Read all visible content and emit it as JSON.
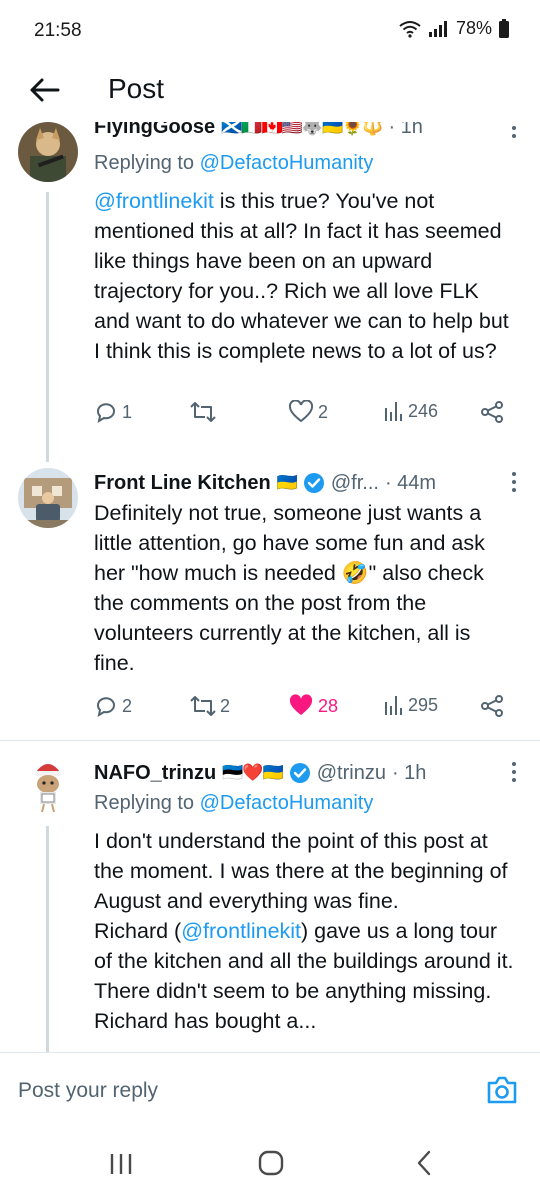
{
  "status_bar": {
    "time": "21:58",
    "battery": "78%"
  },
  "header": {
    "title": "Post"
  },
  "posts": [
    {
      "name": "FlyingGoose",
      "flags": "🏴󠁧󠁢󠁳󠁣󠁴󠁿🇮🇹🇨🇦🇺🇸🐺🇺🇦🌻🔱",
      "time": "· 1h",
      "replying_label": "Replying to",
      "replying_handle": "@DefactoHumanity",
      "text_link": "@frontlinekit",
      "text_rest": " is this true? You've not mentioned this at all? In fact it has seemed like things have been on an upward trajectory for you..? Rich we all love FLK and want to do whatever we can to help but I think this is complete news to a lot of us?",
      "replies": "1",
      "reposts": "",
      "likes": "2",
      "views": "246"
    },
    {
      "name": "Front Line Kitchen",
      "flags": "🇺🇦",
      "handle": "@fr...",
      "time": "· 44m",
      "text": "Definitely not true, someone just wants a little attention, go have some fun and ask her \"how much is needed 🤣\" also check the comments on the post from the volunteers currently at the kitchen, all is fine.",
      "replies": "2",
      "reposts": "2",
      "likes": "28",
      "views": "295"
    },
    {
      "name": "NAFO_trinzu",
      "flags": "🇪🇪❤️🇺🇦",
      "handle": "@trinzu",
      "time": "· 1h",
      "replying_label": "Replying to",
      "replying_handle": "@DefactoHumanity",
      "text_p1": "I don't understand the point of this post at the moment. I was there at the beginning of August and everything was fine.",
      "text_p2_a": "Richard (",
      "text_p2_link": "@frontlinekit",
      "text_p2_b": ")  gave us a long tour of the kitchen and all the buildings around it. There didn't seem to be anything missing. Richard has bought a..."
    }
  ],
  "reply_bar": {
    "placeholder": "Post your reply"
  },
  "colors": {
    "accent": "#1d9bf0",
    "like": "#f91880",
    "muted": "#536471",
    "verified": "#1d9bf0"
  }
}
